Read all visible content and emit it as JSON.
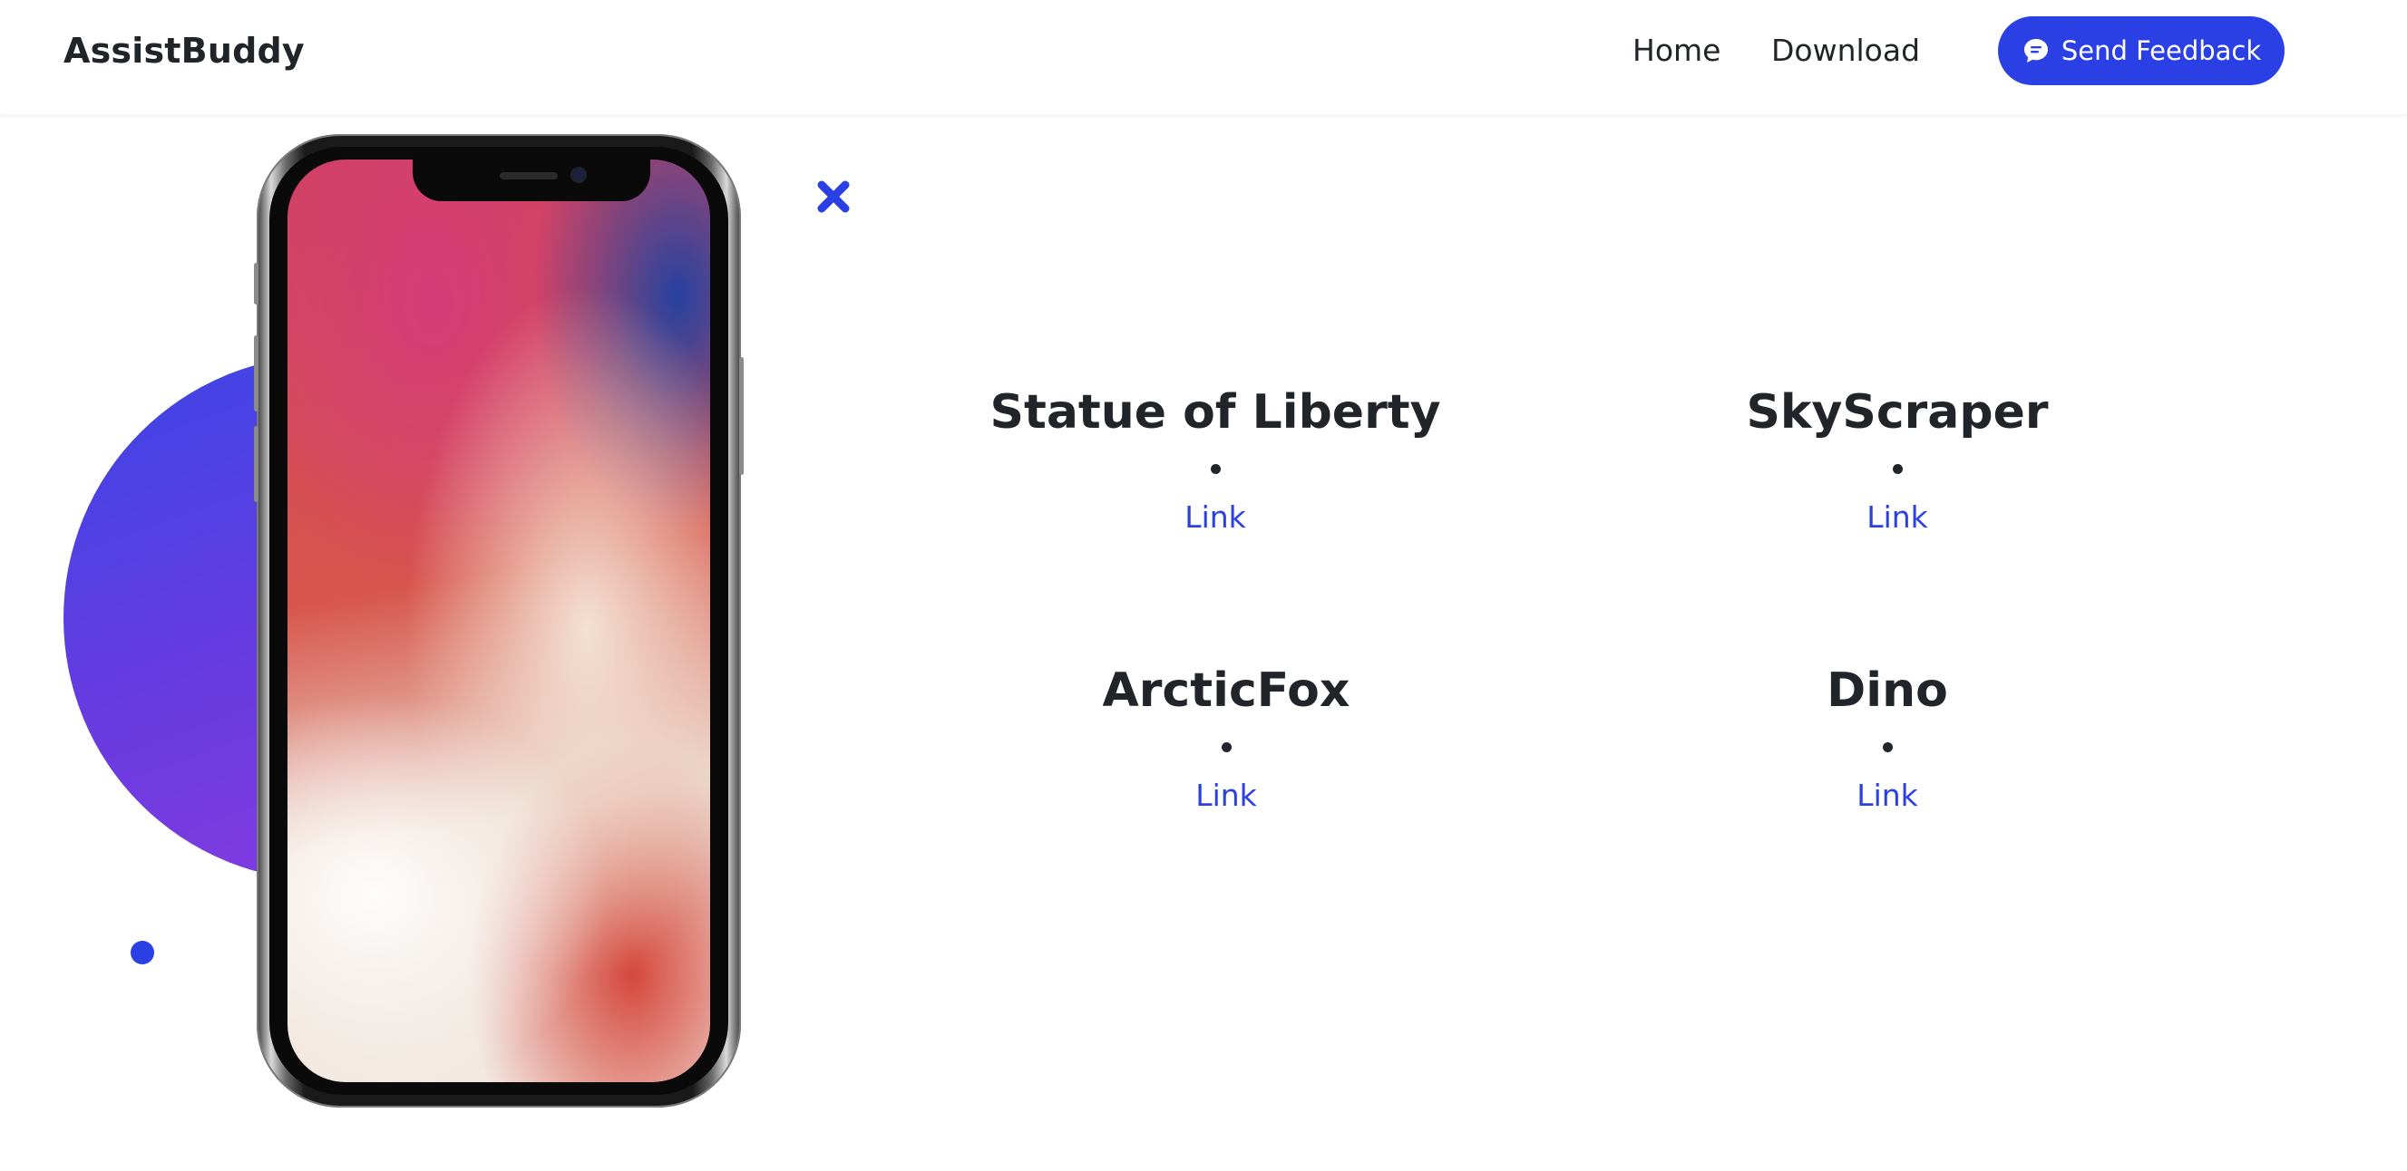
{
  "brand": "AssistBuddy",
  "nav": {
    "home": "Home",
    "download": "Download",
    "feedback": "Send Feedback"
  },
  "cards": [
    {
      "title": "Statue of Liberty",
      "link": "Link"
    },
    {
      "title": "SkyScraper",
      "link": "Link"
    },
    {
      "title": "ArcticFox",
      "link": "Link"
    },
    {
      "title": "Dino",
      "link": "Link"
    }
  ],
  "icons": {
    "feedback": "chat-bubble-icon",
    "decoration": "cross-icon"
  },
  "colors": {
    "accent": "#2a40e5",
    "text": "#212529",
    "blob_start": "#3b45e6",
    "blob_end": "#8a3be0"
  }
}
